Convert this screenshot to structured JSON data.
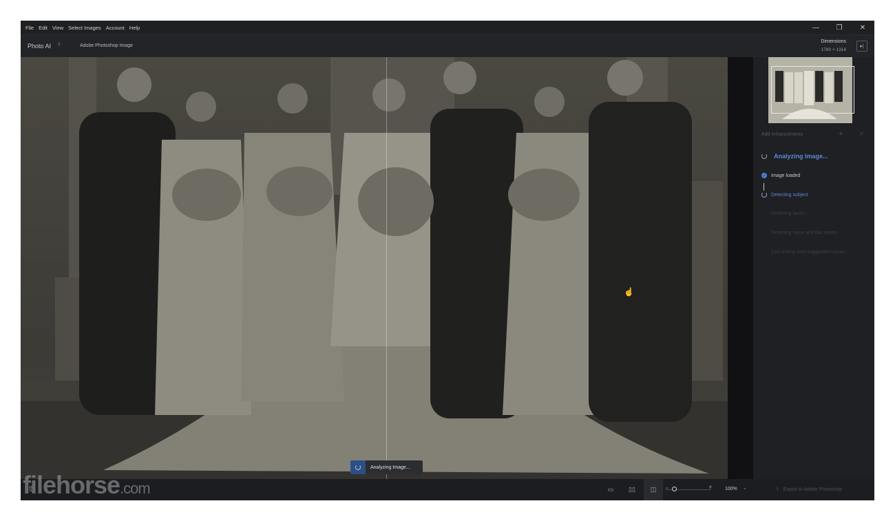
{
  "menu": [
    "File",
    "Edit",
    "View",
    "Select Images",
    "Account",
    "Help"
  ],
  "window_controls": {
    "minimize": "—",
    "restore": "❐",
    "close": "✕"
  },
  "header": {
    "app_name": "Photo AI",
    "badge": "3",
    "source": "Adobe Photoshop Image",
    "dimensions_label": "Dimensions",
    "dimensions_value": "1780 × 1314"
  },
  "canvas": {
    "analyzing_text": "Analyzing Image..."
  },
  "panel": {
    "add_enhancements": "Add enhancements",
    "status_title": "Analyzing Image...",
    "steps": [
      {
        "label": "Image loaded",
        "state": "done"
      },
      {
        "label": "Detecting subject",
        "state": "active"
      },
      {
        "label": "Detecting faces",
        "state": "pending"
      },
      {
        "label": "Detecting noise and blur levels",
        "state": "pending"
      },
      {
        "label": "Calculating auto-suggested values",
        "state": "pending"
      }
    ]
  },
  "bottombar": {
    "zoom_value": "100%",
    "export_label": "Export to Adobe Photoshop",
    "watermark_main": "filehorse",
    "watermark_tld": ".com"
  },
  "colors": {
    "accent": "#5d86d8",
    "done": "#4a7fd6",
    "pending": "#3e3f43",
    "background": "#1b1c1e"
  }
}
